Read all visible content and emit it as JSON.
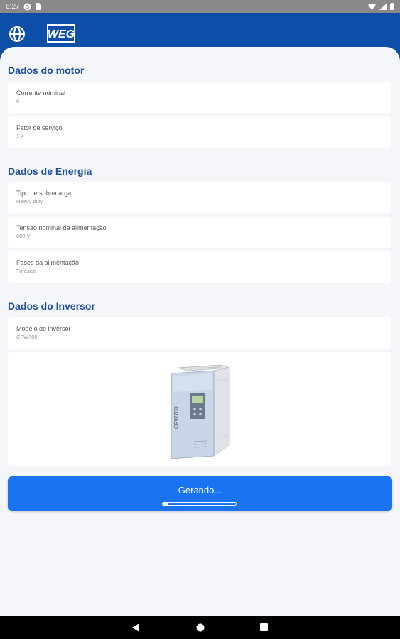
{
  "status_bar": {
    "time": "6:27",
    "icons": [
      "g-icon",
      "sim-icon",
      "wifi-icon",
      "signal-icon",
      "battery-icon"
    ]
  },
  "app_bar": {
    "brand": "WEG",
    "menu_icon": "globe-icon"
  },
  "motor": {
    "title": "Dados do motor",
    "fields": [
      {
        "label": "Corrente nominal",
        "value": "6"
      },
      {
        "label": "Fator de serviço",
        "value": "1.4"
      }
    ]
  },
  "energy": {
    "title": "Dados de Energia",
    "fields": [
      {
        "label": "Tipo de sobrecarga",
        "value": "Heavy duty"
      },
      {
        "label": "Tensão nominal da alimentação",
        "value": "600 V"
      },
      {
        "label": "Fases da alimentação",
        "value": "Trifásica"
      }
    ]
  },
  "inverter": {
    "title": "Dados do Inversor",
    "fields": [
      {
        "label": "Modelo do inversor",
        "value": "CFW700"
      }
    ],
    "image_label": "CFW700"
  },
  "generate": {
    "label": "Gerando...",
    "progress": 0.08
  },
  "colors": {
    "app_bar": "#0d4fa8",
    "accent": "#1a73f0",
    "section_title": "#1c4fa0",
    "background": "#f4f6fa"
  },
  "nav": {
    "back": "back-icon",
    "home": "home-icon",
    "recents": "recents-icon"
  }
}
